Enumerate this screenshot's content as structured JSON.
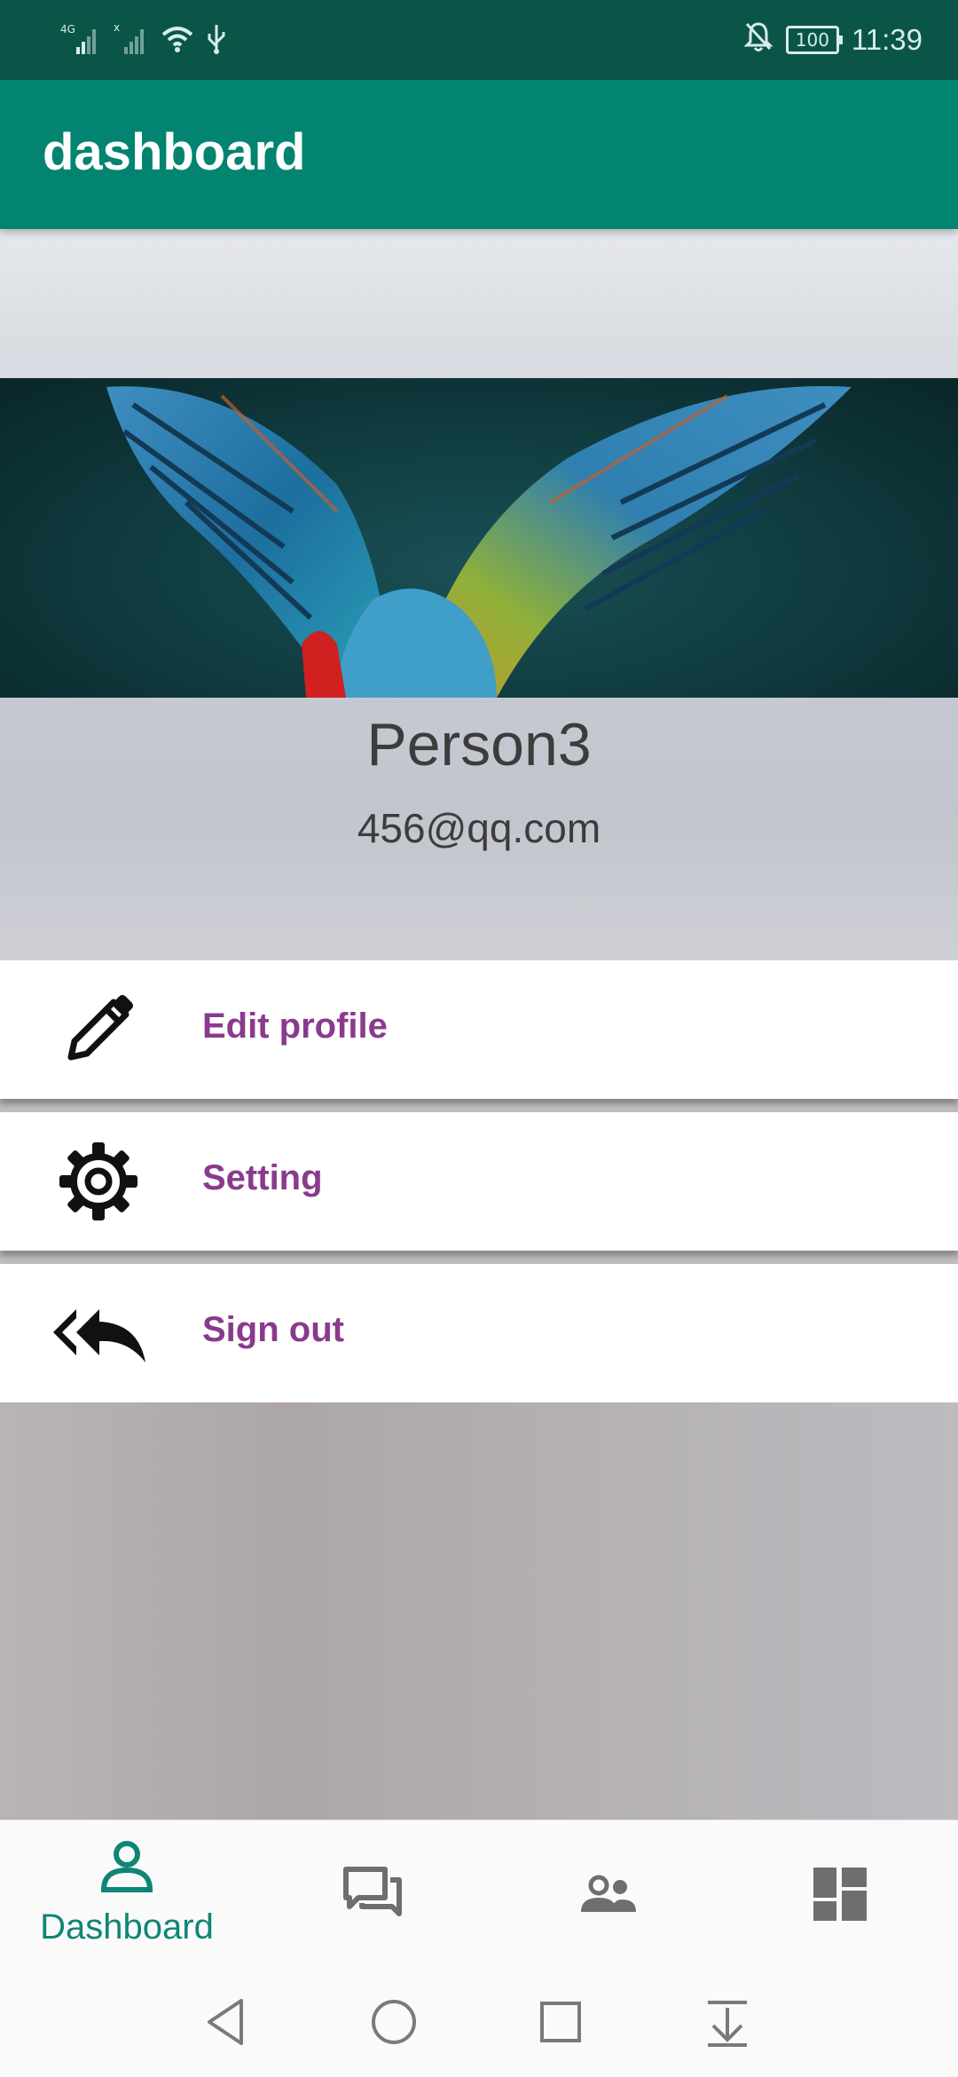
{
  "status_bar": {
    "network_label": "4G",
    "battery": "100",
    "time": "11:39"
  },
  "app_bar": {
    "title": "dashboard"
  },
  "profile": {
    "name": "Person3",
    "email": "456@qq.com"
  },
  "menu": {
    "items": [
      {
        "label": "Edit profile",
        "icon": "pencil-icon"
      },
      {
        "label": "Setting",
        "icon": "gear-icon"
      },
      {
        "label": "Sign out",
        "icon": "reply-all-icon"
      }
    ]
  },
  "bottom_nav": {
    "items": [
      {
        "label": "Dashboard",
        "icon": "person-icon",
        "active": true
      },
      {
        "label": "",
        "icon": "chat-icon",
        "active": false
      },
      {
        "label": "",
        "icon": "people-icon",
        "active": false
      },
      {
        "label": "",
        "icon": "dashboard-grid-icon",
        "active": false
      }
    ],
    "active_color": "#0f8575",
    "inactive_color": "#6e6e6e"
  },
  "colors": {
    "status_bar": "#0a5548",
    "app_bar": "#028471",
    "menu_text": "#8a3a8e"
  }
}
